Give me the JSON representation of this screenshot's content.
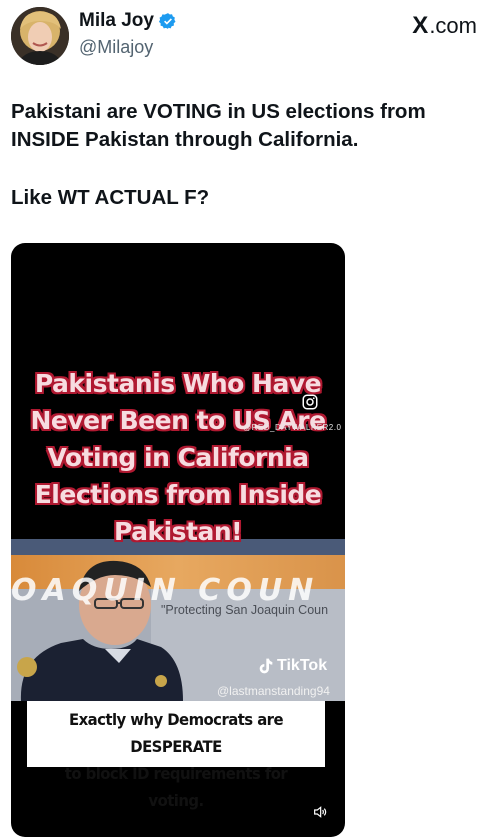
{
  "author": {
    "name": "Mila Joy",
    "handle": "@Milajoy",
    "verified_badge_icon": "verified-badge-icon",
    "verified_color": "#1d9bf0"
  },
  "brand": {
    "x_glyph": "X",
    "suffix": ".com"
  },
  "post": {
    "line1": "Pakistani are VOTING in US elections from INSIDE Pakistan through California.",
    "line2": "Like WT ACTUAL F?"
  },
  "video": {
    "overlay_lines": [
      "Pakistanis Who Have",
      "Never Been to US Are",
      "Voting in California",
      "Elections from Inside",
      "Pakistan!"
    ],
    "overlay_text_color": "#f7dce0",
    "overlay_stroke_color": "#b01931",
    "watermark": "@RED_DAYWALKER2.0",
    "banner_text": "OAQUIN COUN",
    "protecting_text": "\"Protecting San Joaquin Coun",
    "tiktok_label": "TikTok",
    "tiktok_user": "@lastmanstanding94",
    "caption_lines": [
      "Exactly why Democrats are DESPERATE",
      "to block ID requirements for voting."
    ],
    "sound_icon": "speaker-icon"
  }
}
